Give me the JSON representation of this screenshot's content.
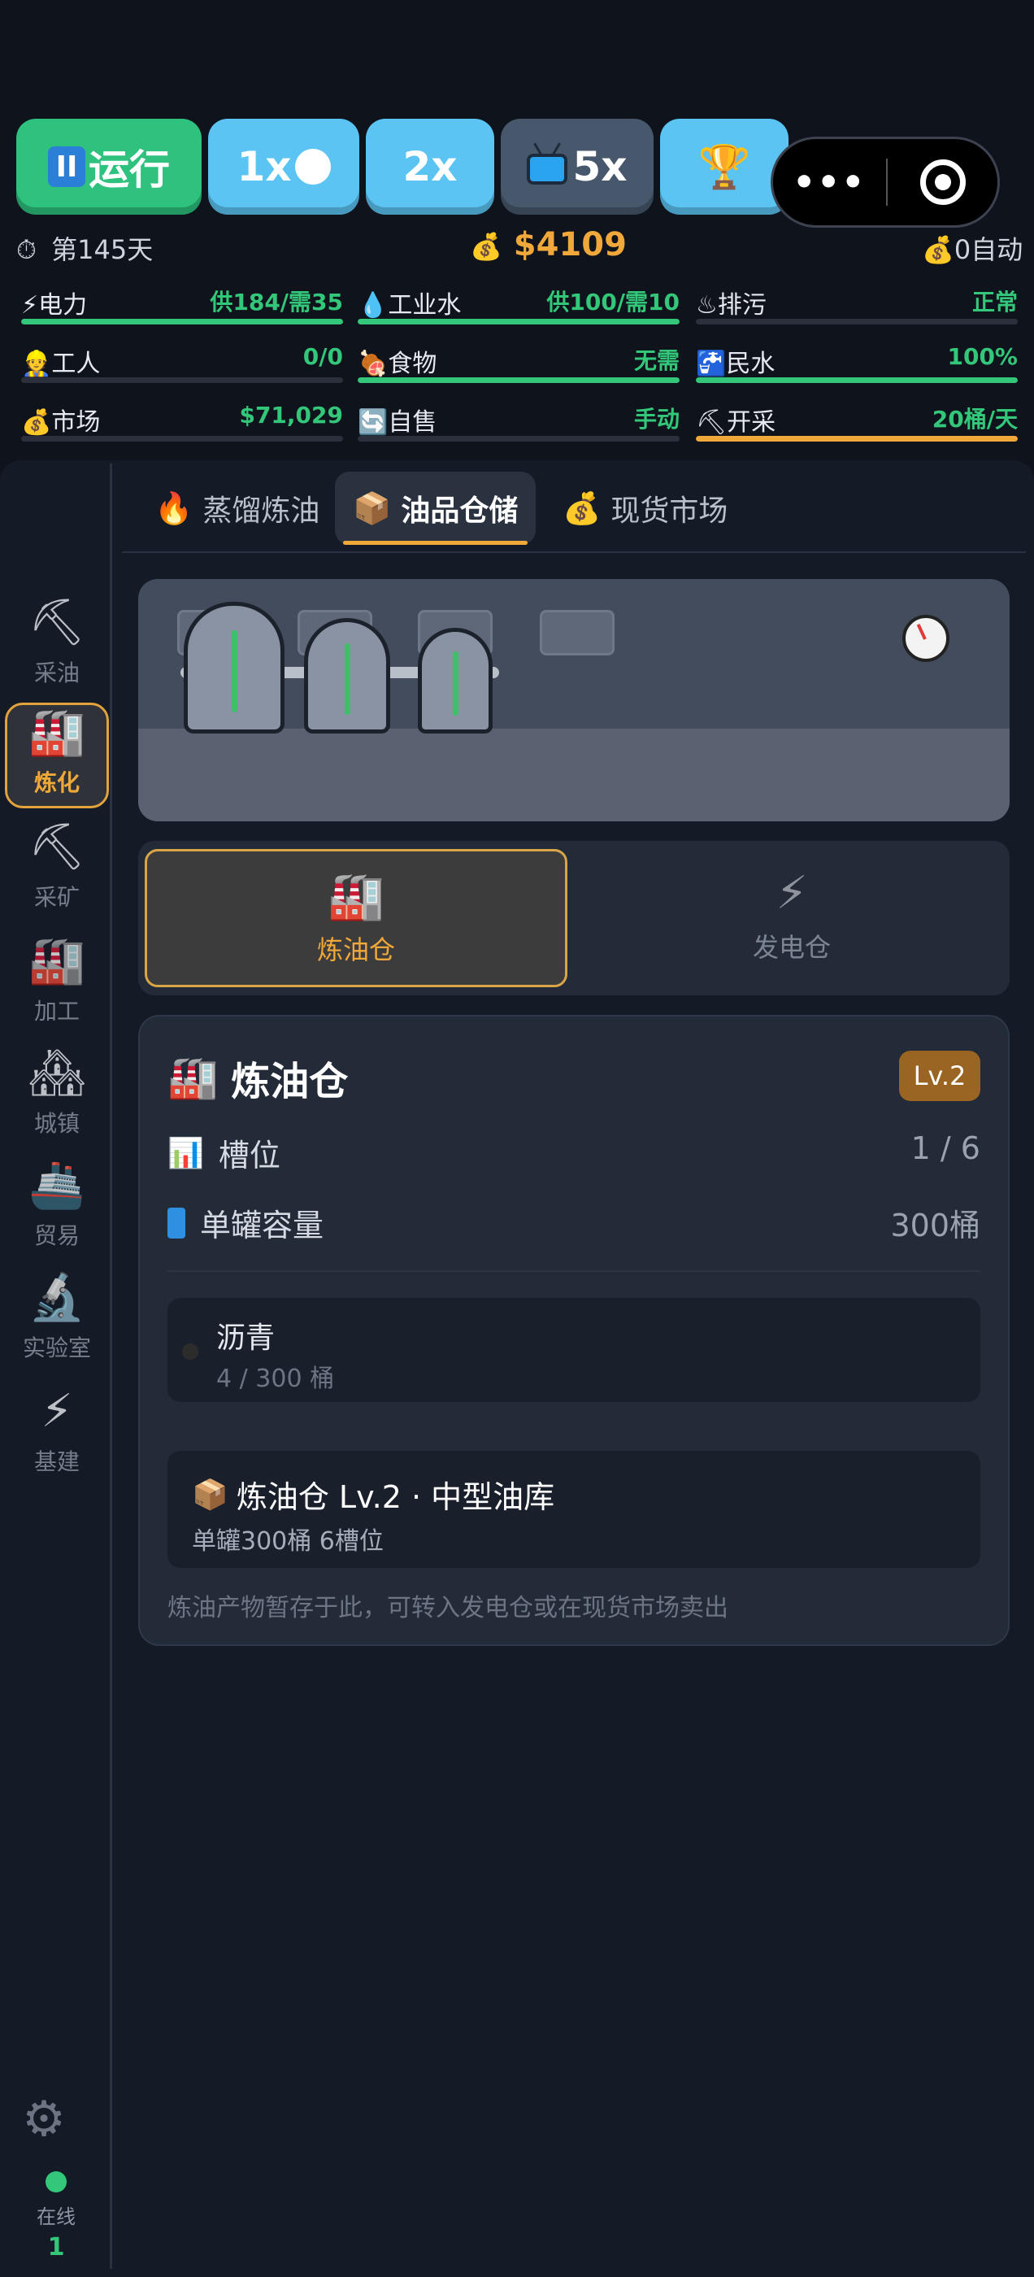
{
  "controls": {
    "run": {
      "glyph": "II",
      "label": "运行"
    },
    "speed1": "1x",
    "speed2": "2x",
    "speed5": "5x",
    "trophy_icon": "🏆",
    "menu_more": "•••"
  },
  "info": {
    "day": "第145天",
    "money": "$4109",
    "auto": "0自动"
  },
  "stats": [
    {
      "icon": "⚡",
      "label": "电力",
      "value": "供184/需35",
      "level": 1.0,
      "color": "#33c77a"
    },
    {
      "icon": "💧",
      "label": "工业水",
      "value": "供100/需10",
      "level": 1.0,
      "color": "#33c77a"
    },
    {
      "icon": "♨",
      "label": "排污",
      "value": "正常",
      "level": 0.0,
      "color": "#33c77a"
    },
    {
      "icon": "👷",
      "label": "工人",
      "value": "0/0",
      "level": 0.0,
      "color": "#33c77a"
    },
    {
      "icon": "🍖",
      "label": "食物",
      "value": "无需",
      "level": 1.0,
      "color": "#33c77a"
    },
    {
      "icon": "🚰",
      "label": "民水",
      "value": "100%",
      "level": 1.0,
      "color": "#33c77a"
    },
    {
      "icon": "💰",
      "label": "市场",
      "value": "$71,029",
      "level": 0.0,
      "color": "#33c77a"
    },
    {
      "icon": "🔄",
      "label": "自售",
      "value": "手动",
      "level": 0.0,
      "color": "#33c77a"
    },
    {
      "icon": "⛏",
      "label": "开采",
      "value": "20桶/天",
      "level": 1.0,
      "color": "#f0a83a"
    }
  ],
  "sidebar": [
    {
      "icon": "⛏",
      "label": "采油"
    },
    {
      "icon": "🏭",
      "label": "炼化"
    },
    {
      "icon": "⛏",
      "label": "采矿"
    },
    {
      "icon": "🏭",
      "label": "加工"
    },
    {
      "icon": "🏘",
      "label": "城镇"
    },
    {
      "icon": "🚢",
      "label": "贸易"
    },
    {
      "icon": "🔬",
      "label": "实验室"
    },
    {
      "icon": "⚡",
      "label": "基建"
    }
  ],
  "tabs": [
    {
      "icon": "🔥",
      "label": "蒸馏炼油"
    },
    {
      "icon": "📦",
      "label": "油品仓储"
    },
    {
      "icon": "💰",
      "label": "现货市场"
    }
  ],
  "switcher": [
    {
      "icon": "🏭",
      "label": "炼油仓"
    },
    {
      "icon": "⚡",
      "label": "发电仓"
    }
  ],
  "card": {
    "icon": "🏭",
    "title": "炼油仓",
    "level": "Lv.2",
    "slots_label": "槽位",
    "slots_value": "1 / 6",
    "capacity_label": "单罐容量",
    "capacity_value": "300桶",
    "slot_item": {
      "name": "沥青",
      "amount": "4 / 300 桶"
    },
    "upgrade": {
      "icon": "📦",
      "title": "炼油仓 Lv.2 · 中型油库",
      "subtitle": "单罐300桶 6槽位"
    },
    "note": "炼油产物暂存于此，可转入发电仓或在现货市场卖出"
  },
  "footer": {
    "online_label": "在线",
    "online_count": "1"
  }
}
